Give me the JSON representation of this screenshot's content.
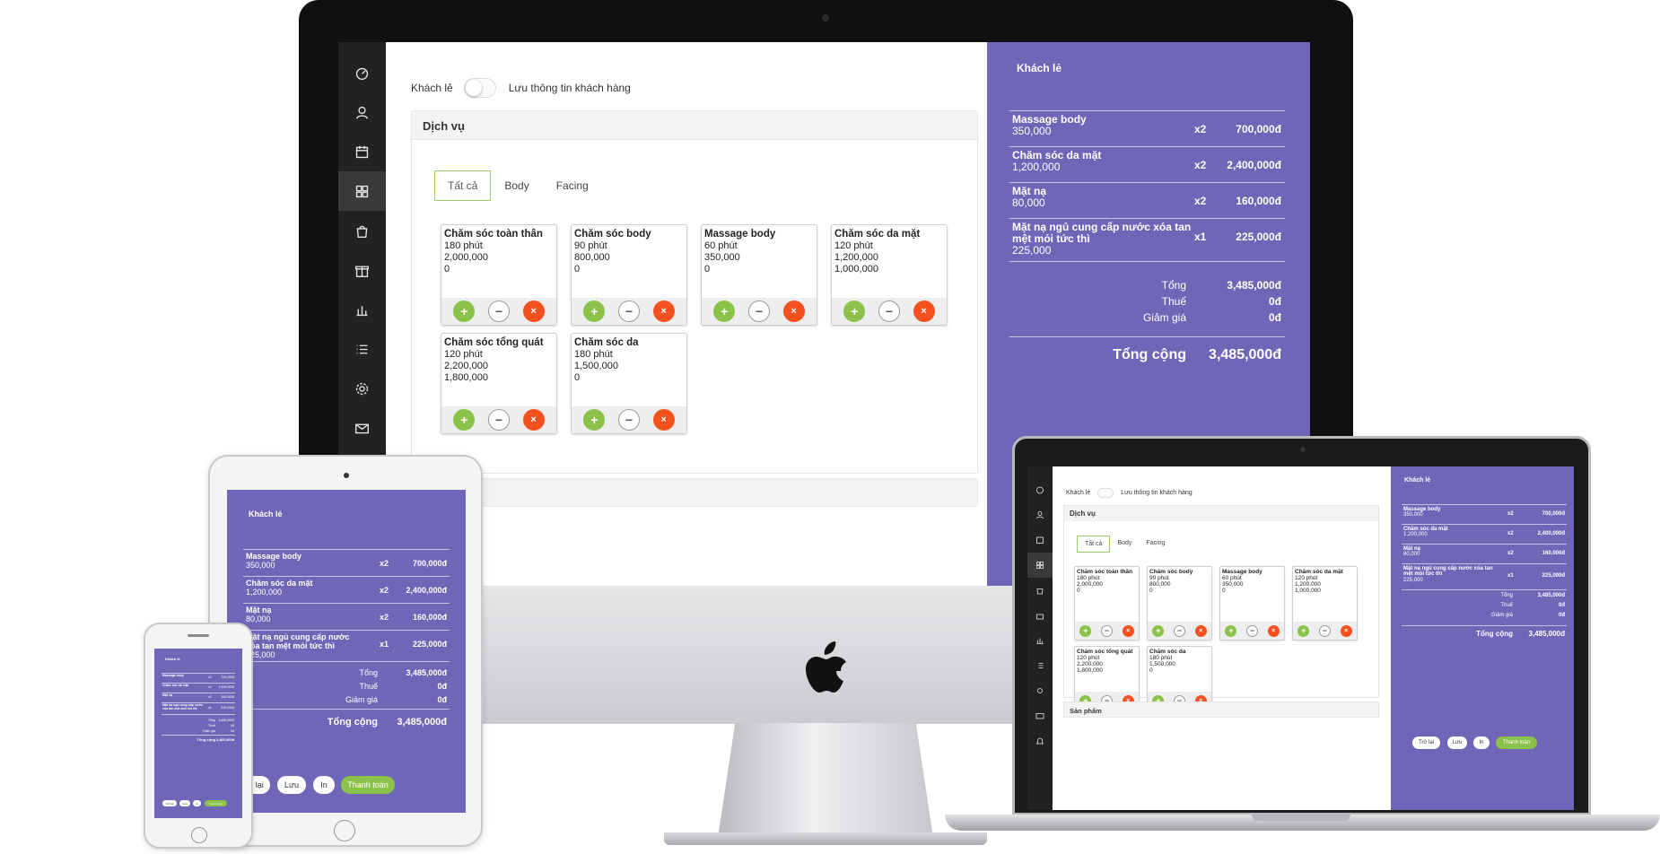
{
  "pos": {
    "customer_label": "Khách lẻ",
    "save_customer_label": "Lưu thông tin khách hàng",
    "services_panel_title": "Dịch vụ",
    "products_panel_title": "Sản phẩm",
    "tabs": [
      {
        "label": "Tất cả",
        "active": true
      },
      {
        "label": "Body",
        "active": false
      },
      {
        "label": "Facing",
        "active": false
      }
    ],
    "services": [
      {
        "name": "Chăm sóc toàn thân",
        "duration": "180 phút",
        "price": "2,000,000",
        "qty": "0"
      },
      {
        "name": "Chăm sóc body",
        "duration": "90 phút",
        "price": "800,000",
        "qty": "0"
      },
      {
        "name": "Massage body",
        "duration": "60 phút",
        "price": "350,000",
        "qty": "0"
      },
      {
        "name": "Chăm sóc da mặt",
        "duration": "120 phút",
        "price": "1,200,000",
        "qty": "1,000,000"
      },
      {
        "name": "Chăm sóc tổng quát",
        "duration": "120 phút",
        "price": "2,200,000",
        "qty": "1,800,000"
      },
      {
        "name": "Chăm sóc da",
        "duration": "180 phút",
        "price": "1,500,000",
        "qty": "0"
      }
    ],
    "action_glyphs": {
      "add": "+",
      "remove": "−",
      "delete": "×"
    },
    "sidebar_icons": [
      "dashboard-icon",
      "customer-icon",
      "calendar-icon",
      "grid-icon",
      "bag-icon",
      "gift-icon",
      "chart-icon",
      "list-icon",
      "gear-icon",
      "mail-icon",
      "bell-icon"
    ]
  },
  "bill": {
    "title": "Khách lẻ",
    "items": [
      {
        "name": "Massage body",
        "price": "350,000",
        "qty": "x2",
        "amount": "700,000đ"
      },
      {
        "name": "Chăm sóc da mặt",
        "price": "1,200,000",
        "qty": "x2",
        "amount": "2,400,000đ"
      },
      {
        "name": "Mặt nạ",
        "price": "80,000",
        "qty": "x2",
        "amount": "160,000đ"
      },
      {
        "name": "Mặt nạ ngủ cung cấp nước xóa tan mệt mỏi tức thì",
        "price": "225,000",
        "qty": "x1",
        "amount": "225,000đ"
      }
    ],
    "subtotal_label": "Tổng",
    "subtotal": "3,485,000đ",
    "tax_label": "Thuế",
    "tax": "0đ",
    "discount_label": "Giảm giá",
    "discount": "0đ",
    "total_label": "Tổng cộng",
    "total": "3,485,000đ",
    "buttons": {
      "back": "Trở lại",
      "save": "Lưu",
      "print": "In",
      "pay": "Thanh toán"
    }
  },
  "colors": {
    "accent": "#7066b8",
    "green": "#8bc34a",
    "red": "#f4511e",
    "sidebar": "#222222"
  }
}
